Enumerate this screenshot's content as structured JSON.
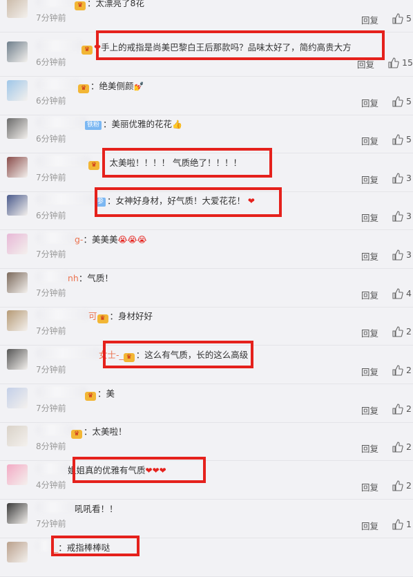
{
  "comments": [
    {
      "prefix": "",
      "text": "：太漂亮了8花",
      "time": "7分钟前",
      "reply": "回复",
      "likes": "5"
    },
    {
      "prefix": "",
      "text": "手上的戒指是尚美巴黎白王后那款吗？品味太好了，简约高贵大方",
      "time": "6分钟前",
      "reply": "回复",
      "likes": "15"
    },
    {
      "prefix": "",
      "text": "：绝美侧颜",
      "time": "6分钟前",
      "reply": "回复",
      "likes": "5"
    },
    {
      "prefix": "铁粉",
      "text": "：美丽优雅的花花",
      "time": "6分钟前",
      "reply": "回复",
      "likes": "5"
    },
    {
      "prefix": "",
      "text": "：太美啦！！！！ 气质绝了！！！！",
      "time": "7分钟前",
      "reply": "回复",
      "likes": "3"
    },
    {
      "prefix": "参",
      "text": "：女神好身材，好气质！大爱花花！",
      "time": "6分钟前",
      "reply": "回复",
      "likes": "3"
    },
    {
      "prefix": "g-",
      "text": "：美美美",
      "time": "7分钟前",
      "reply": "回复",
      "likes": "3"
    },
    {
      "prefix": "nh",
      "text": "：气质！",
      "time": "7分钟前",
      "reply": "回复",
      "likes": "4"
    },
    {
      "prefix": "可",
      "text": "：身材好好",
      "time": "7分钟前",
      "reply": "回复",
      "likes": "2"
    },
    {
      "prefix": "女士-_",
      "text": "：这么有气质，长的这么高级",
      "time": "7分钟前",
      "reply": "回复",
      "likes": "2"
    },
    {
      "prefix": "",
      "text": "：美",
      "time": "7分钟前",
      "reply": "回复",
      "likes": "2"
    },
    {
      "prefix": "",
      "text": "：太美啦！",
      "time": "8分钟前",
      "reply": "回复",
      "likes": "2"
    },
    {
      "prefix": "",
      "text": "姐姐真的优雅有气质",
      "time": "4分钟前",
      "reply": "回复",
      "likes": "2"
    },
    {
      "prefix": "",
      "text": "吼吼看！！",
      "time": "7分钟前",
      "reply": "回复",
      "likes": "1"
    },
    {
      "prefix": "_",
      "text": "：戒指棒棒哒",
      "time": "",
      "reply": "",
      "likes": ""
    }
  ],
  "colors": {
    "highlight": "#e5211c",
    "background": "#f2f2f5",
    "fan_badge": "#f2b635"
  }
}
